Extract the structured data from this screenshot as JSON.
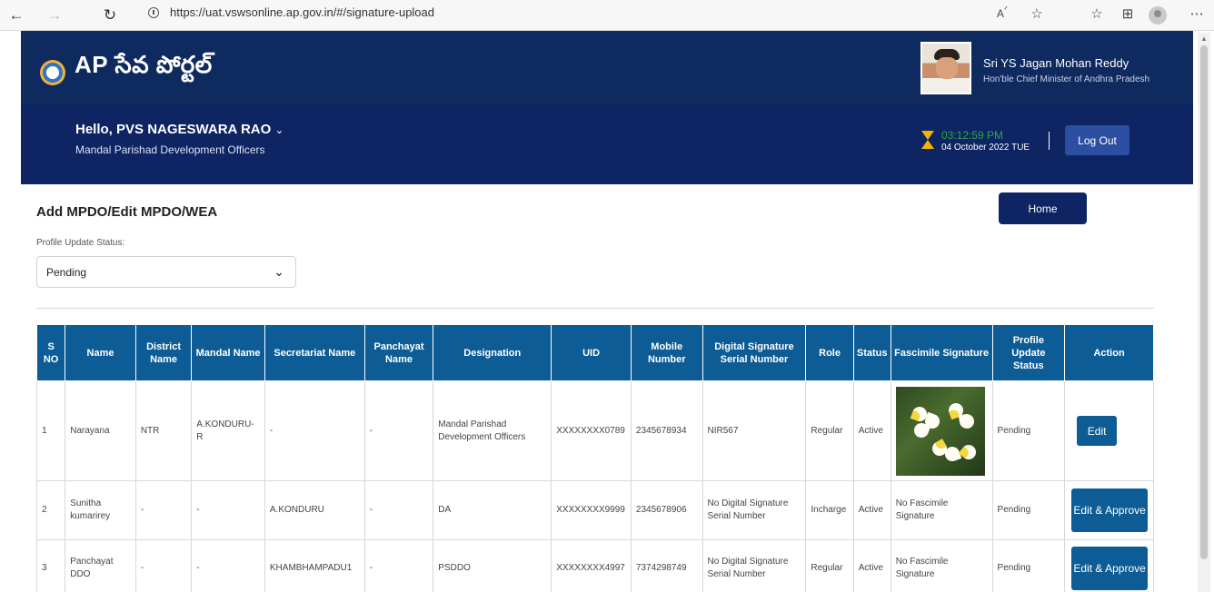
{
  "browser": {
    "url": "https://uat.vswsonline.ap.gov.in/#/signature-upload",
    "icons": [
      "back-arrow-icon",
      "forward-arrow-icon",
      "refresh-icon",
      "site-info-icon",
      "read-aloud-icon",
      "favorites-add-icon",
      "favorites-icon",
      "collections-icon",
      "profile-icon",
      "more-icon"
    ]
  },
  "header": {
    "logo_text": "AP సేవ పోర్టల్",
    "cm_name": "Sri YS Jagan Mohan Reddy",
    "cm_title": "Hon'ble Chief Minister of Andhra Pradesh"
  },
  "user": {
    "greeting": "Hello, PVS NAGESWARA RAO",
    "department": "Mandal Parishad Development Officers",
    "time": "03:12:59 PM",
    "date": "04 October 2022 TUE",
    "logout_label": "Log Out"
  },
  "page": {
    "title": "Add MPDO/Edit MPDO/WEA",
    "home_label": "Home",
    "status_label": "Profile Update Status:",
    "status_value": "Pending"
  },
  "table": {
    "headers": [
      "S NO",
      "Name",
      "District Name",
      "Mandal Name",
      "Secretariat Name",
      "Panchayat Name",
      "Designation",
      "UID",
      "Mobile Number",
      "Digital Signature Serial Number",
      "Role",
      "Status",
      "Fascimile Signature",
      "Profile Update Status",
      "Action"
    ],
    "rows": [
      {
        "sno": "1",
        "name": "Narayana",
        "district": "NTR",
        "mandal": "A.KONDURU-R",
        "secretariat": "-",
        "panchayat": "-",
        "designation": "Mandal Parishad Development Officers",
        "uid": "XXXXXXXX0789",
        "mobile": "2345678934",
        "dsig": "NIR567",
        "role": "Regular",
        "status": "Active",
        "fascimile": "",
        "profile_status": "Pending",
        "action": "Edit"
      },
      {
        "sno": "2",
        "name": "Sunitha kumarirey",
        "district": "-",
        "mandal": "-",
        "secretariat": "A.KONDURU",
        "panchayat": "-",
        "designation": "DA",
        "uid": "XXXXXXXX9999",
        "mobile": "2345678906",
        "dsig": "No Digital Signature Serial Number",
        "role": "Incharge",
        "status": "Active",
        "fascimile": "No Fascimile Signature",
        "profile_status": "Pending",
        "action": "Edit & Approve"
      },
      {
        "sno": "3",
        "name": "Panchayat DDO",
        "district": "-",
        "mandal": "-",
        "secretariat": "KHAMBHAMPADU1",
        "panchayat": "-",
        "designation": "PSDDO",
        "uid": "XXXXXXXX4997",
        "mobile": "7374298749",
        "dsig": "No Digital Signature Serial Number",
        "role": "Regular",
        "status": "Active",
        "fascimile": "No Fascimile Signature",
        "profile_status": "Pending",
        "action": "Edit & Approve"
      }
    ]
  },
  "colors": {
    "header_band": "#0f2a5e",
    "user_band": "#0e2463",
    "table_header": "#0d5c95",
    "clock_green": "#2aa84a"
  }
}
